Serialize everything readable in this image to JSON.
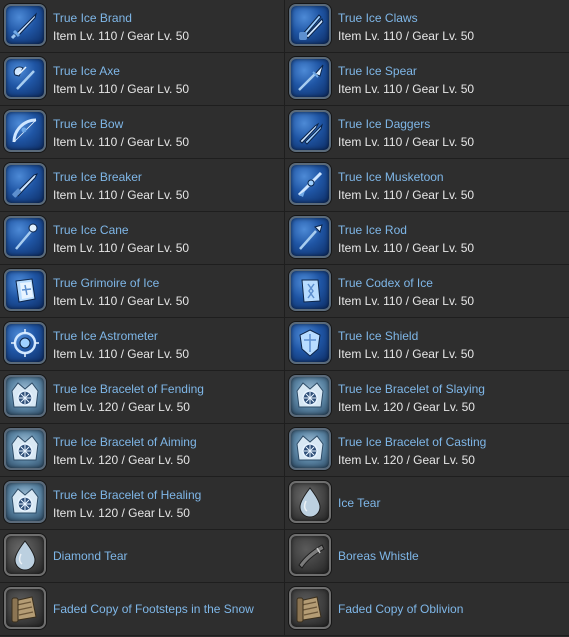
{
  "items": [
    {
      "name": "True Ice Brand",
      "meta": "Item Lv. 110 / Gear Lv. 50",
      "icon": "sword-icon",
      "kind": "weapon"
    },
    {
      "name": "True Ice Claws",
      "meta": "Item Lv. 110 / Gear Lv. 50",
      "icon": "claws-icon",
      "kind": "weapon"
    },
    {
      "name": "True Ice Axe",
      "meta": "Item Lv. 110 / Gear Lv. 50",
      "icon": "axe-icon",
      "kind": "weapon"
    },
    {
      "name": "True Ice Spear",
      "meta": "Item Lv. 110 / Gear Lv. 50",
      "icon": "spear-icon",
      "kind": "weapon"
    },
    {
      "name": "True Ice Bow",
      "meta": "Item Lv. 110 / Gear Lv. 50",
      "icon": "bow-icon",
      "kind": "weapon"
    },
    {
      "name": "True Ice Daggers",
      "meta": "Item Lv. 110 / Gear Lv. 50",
      "icon": "daggers-icon",
      "kind": "weapon"
    },
    {
      "name": "True Ice Breaker",
      "meta": "Item Lv. 110 / Gear Lv. 50",
      "icon": "gunblade-icon",
      "kind": "weapon"
    },
    {
      "name": "True Ice Musketoon",
      "meta": "Item Lv. 110 / Gear Lv. 50",
      "icon": "musket-icon",
      "kind": "weapon"
    },
    {
      "name": "True Ice Cane",
      "meta": "Item Lv. 110 / Gear Lv. 50",
      "icon": "cane-icon",
      "kind": "weapon"
    },
    {
      "name": "True Ice Rod",
      "meta": "Item Lv. 110 / Gear Lv. 50",
      "icon": "rod-icon",
      "kind": "weapon"
    },
    {
      "name": "True Grimoire of Ice",
      "meta": "Item Lv. 110 / Gear Lv. 50",
      "icon": "grimoire-icon",
      "kind": "weapon"
    },
    {
      "name": "True Codex of Ice",
      "meta": "Item Lv. 110 / Gear Lv. 50",
      "icon": "codex-icon",
      "kind": "weapon"
    },
    {
      "name": "True Ice Astrometer",
      "meta": "Item Lv. 110 / Gear Lv. 50",
      "icon": "astrometer-icon",
      "kind": "weapon"
    },
    {
      "name": "True Ice Shield",
      "meta": "Item Lv. 110 / Gear Lv. 50",
      "icon": "shield-icon",
      "kind": "weapon"
    },
    {
      "name": "True Ice Bracelet of Fending",
      "meta": "Item Lv. 120 / Gear Lv. 50",
      "icon": "bracelet-icon",
      "kind": "bracelet"
    },
    {
      "name": "True Ice Bracelet of Slaying",
      "meta": "Item Lv. 120 / Gear Lv. 50",
      "icon": "bracelet-icon",
      "kind": "bracelet"
    },
    {
      "name": "True Ice Bracelet of Aiming",
      "meta": "Item Lv. 120 / Gear Lv. 50",
      "icon": "bracelet-icon",
      "kind": "bracelet"
    },
    {
      "name": "True Ice Bracelet of Casting",
      "meta": "Item Lv. 120 / Gear Lv. 50",
      "icon": "bracelet-icon",
      "kind": "bracelet"
    },
    {
      "name": "True Ice Bracelet of Healing",
      "meta": "Item Lv. 120 / Gear Lv. 50",
      "icon": "bracelet-icon",
      "kind": "bracelet"
    },
    {
      "name": "Ice Tear",
      "meta": "",
      "icon": "tear-icon",
      "kind": "tear"
    },
    {
      "name": "Diamond Tear",
      "meta": "",
      "icon": "tear-icon",
      "kind": "tear"
    },
    {
      "name": "Boreas Whistle",
      "meta": "",
      "icon": "whistle-icon",
      "kind": "parchment"
    },
    {
      "name": "Faded Copy of Footsteps in the Snow",
      "meta": "",
      "icon": "scroll-icon",
      "kind": "parchment"
    },
    {
      "name": "Faded Copy of Oblivion",
      "meta": "",
      "icon": "scroll-icon",
      "kind": "parchment"
    }
  ]
}
